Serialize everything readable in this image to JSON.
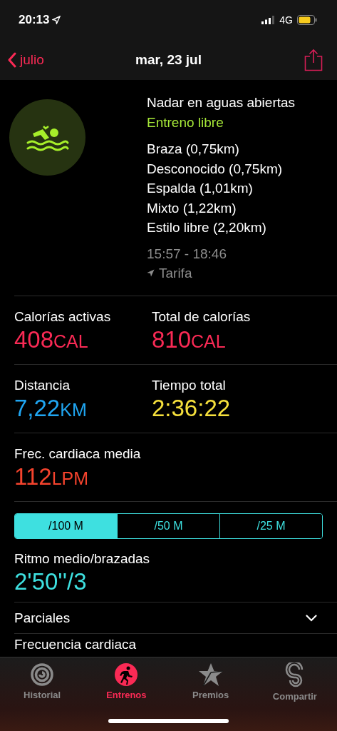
{
  "status_bar": {
    "time": "20:13",
    "network": "4G"
  },
  "nav": {
    "back": "julio",
    "title": "mar, 23 jul"
  },
  "workout": {
    "name": "Nadar en aguas abiertas",
    "type": "Entreno libre",
    "strokes": [
      "Braza (0,75km)",
      "Desconocido (0,75km)",
      "Espalda (1,01km)",
      "Mixto (1,22km)",
      "Estilo libre (2,20km)"
    ],
    "time_range": "15:57 - 18:46",
    "location": "Tarifa"
  },
  "metric_rows": [
    [
      {
        "label": "Calorías activas",
        "value": "408",
        "unit": "CAL",
        "color": "#fa2a55"
      },
      {
        "label": "Total de calorías",
        "value": "810",
        "unit": "CAL",
        "color": "#fa2a55"
      }
    ],
    [
      {
        "label": "Distancia",
        "value": "7,22",
        "unit": "KM",
        "color": "#20a6f2"
      },
      {
        "label": "Tiempo total",
        "value": "2:36:22",
        "color": "#f6e03c"
      }
    ],
    [
      {
        "label": "Frec. cardiaca media",
        "value": "112",
        "unit": "LPM",
        "color": "#f5432d"
      }
    ]
  ],
  "pace_units": [
    {
      "label": "/100 M",
      "selected": true
    },
    {
      "label": "/50 M",
      "selected": false
    },
    {
      "label": "/25 M",
      "selected": false
    }
  ],
  "pace": {
    "label": "Ritmo medio/brazadas",
    "value": "2'50''/3"
  },
  "sections": [
    {
      "label": "Parciales",
      "expanded": false
    },
    {
      "label": "Frecuencia cardiaca"
    }
  ],
  "tabs": [
    {
      "label": "Historial",
      "selected": false
    },
    {
      "label": "Entrenos",
      "selected": true
    },
    {
      "label": "Premios",
      "selected": false
    },
    {
      "label": "Compartir",
      "selected": false
    }
  ]
}
